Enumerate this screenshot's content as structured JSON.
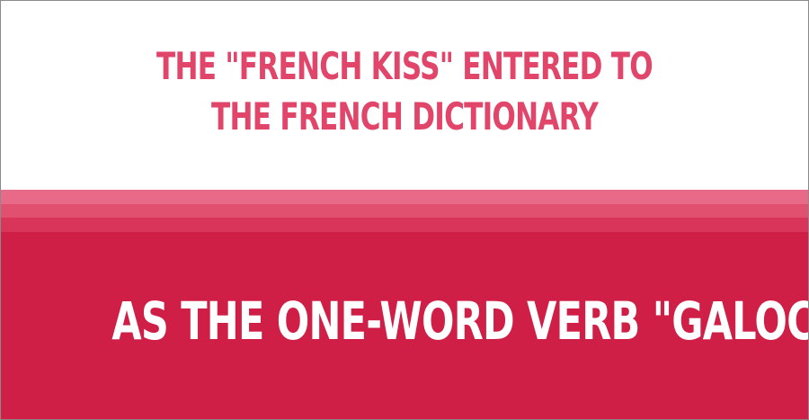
{
  "card": {
    "headline": "THE \"FRENCH KISS\" ENTERED TO THE FRENCH DICTIONARY",
    "statement": "AS THE ONE-WORD VERB \"GALOCHER\"."
  },
  "colors": {
    "headline": "#e2456a",
    "stripe_light": "#e86a88",
    "stripe_mid": "#e2506f",
    "stripe_dark": "#d9355a",
    "panel": "#cf1f47",
    "statement": "#ffffff",
    "background": "#ffffff"
  }
}
